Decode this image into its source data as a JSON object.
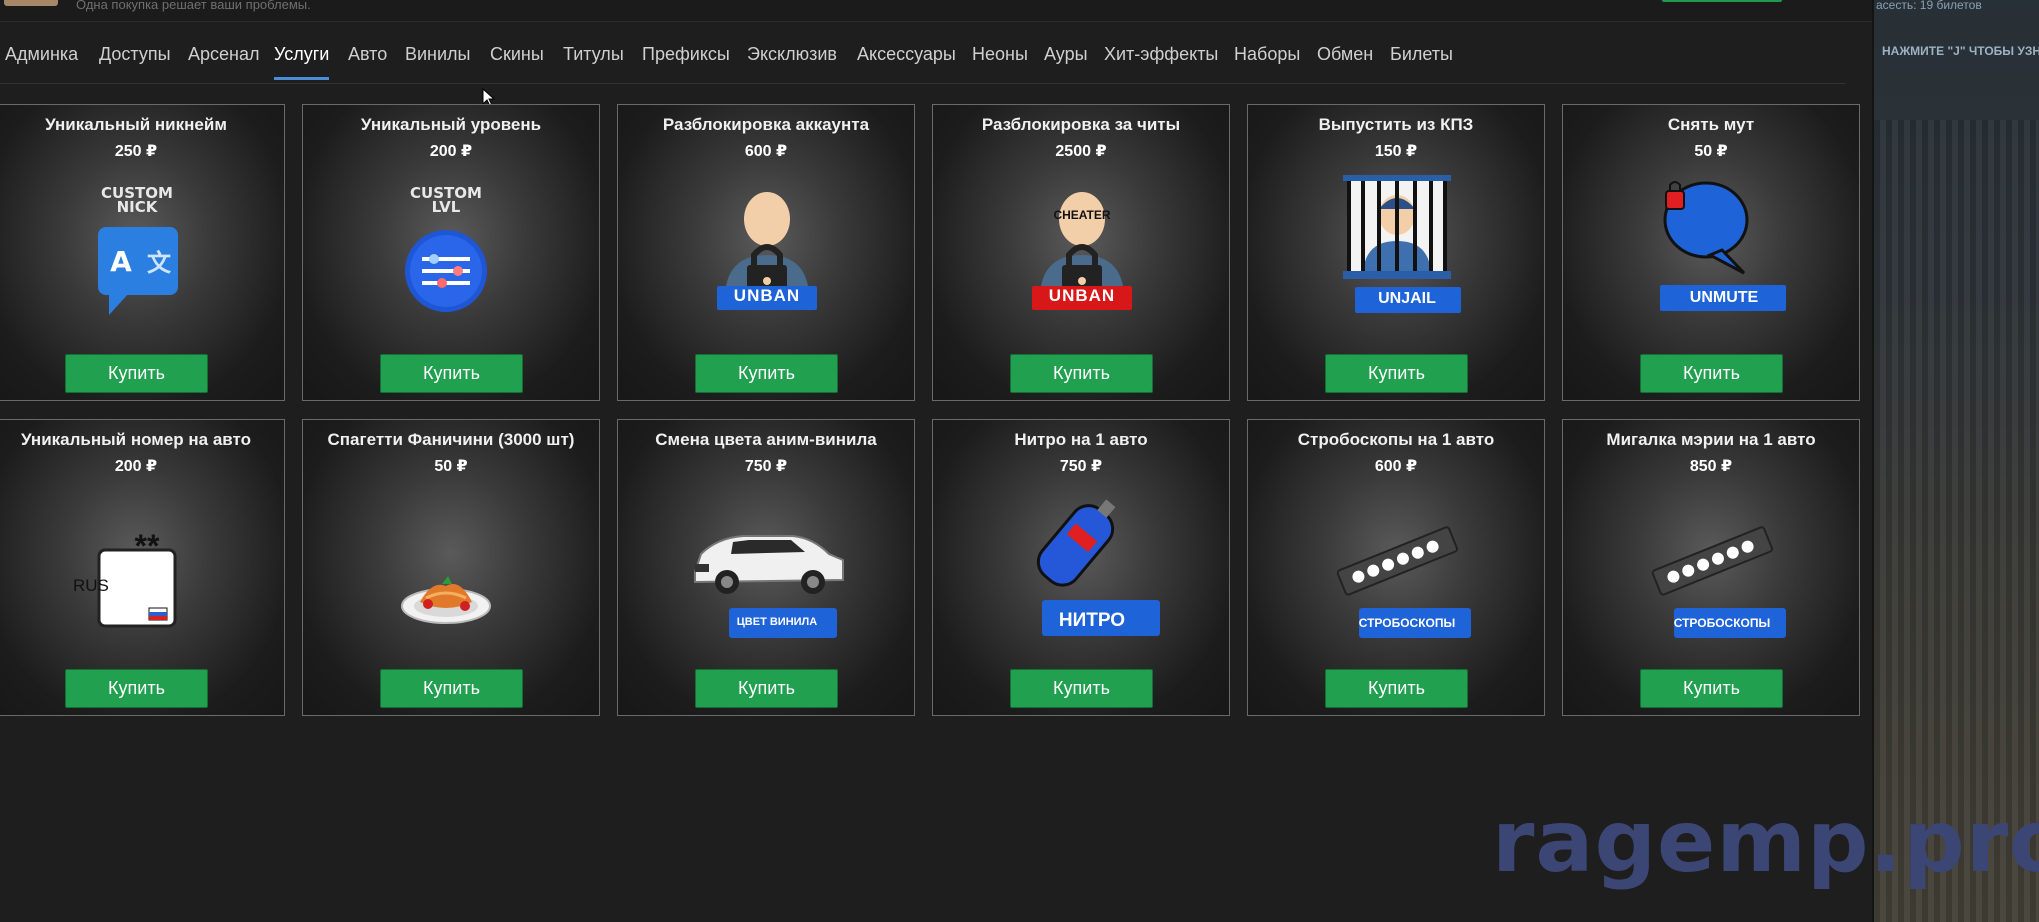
{
  "header": {
    "subtitle": "Одна покупка решает ваши проблемы."
  },
  "side": {
    "tickets": "асесть: 19 билетов",
    "hint": "НАЖМИТЕ \"J\" ЧТОБЫ УЗН"
  },
  "nav": {
    "tabs": [
      {
        "label": "Админка",
        "active": false
      },
      {
        "label": "Доступы",
        "active": false
      },
      {
        "label": "Арсенал",
        "active": false
      },
      {
        "label": "Услуги",
        "active": true
      },
      {
        "label": "Авто",
        "active": false
      },
      {
        "label": "Винилы",
        "active": false
      },
      {
        "label": "Скины",
        "active": false
      },
      {
        "label": "Титулы",
        "active": false
      },
      {
        "label": "Префиксы",
        "active": false
      },
      {
        "label": "Эксклюзив",
        "active": false
      },
      {
        "label": "Аксессуары",
        "active": false
      },
      {
        "label": "Неоны",
        "active": false
      },
      {
        "label": "Ауры",
        "active": false
      },
      {
        "label": "Хит-эффекты",
        "active": false
      },
      {
        "label": "Наборы",
        "active": false
      },
      {
        "label": "Обмен",
        "active": false
      },
      {
        "label": "Билеты",
        "active": false
      }
    ]
  },
  "buy_label": "Купить",
  "cards": [
    {
      "title": "Уникальный никнейм",
      "price": "250 ₽",
      "icon": "custom-nick-icon",
      "badge": "",
      "caption": "CUSTOM NICK"
    },
    {
      "title": "Уникальный уровень",
      "price": "200 ₽",
      "icon": "custom-level-icon",
      "badge": "",
      "caption": "CUSTOM LVL"
    },
    {
      "title": "Разблокировка аккаунта",
      "price": "600 ₽",
      "icon": "unban-icon",
      "badge": "UNBAN",
      "caption": ""
    },
    {
      "title": "Разблокировка за читы",
      "price": "2500 ₽",
      "icon": "cheater-unban-icon",
      "badge": "UNBAN",
      "caption": "CHEATER"
    },
    {
      "title": "Выпустить из КПЗ",
      "price": "150 ₽",
      "icon": "unjail-icon",
      "badge": "UNJAIL",
      "caption": ""
    },
    {
      "title": "Снять мут",
      "price": "50 ₽",
      "icon": "unmute-icon",
      "badge": "UNMUTE",
      "caption": ""
    },
    {
      "title": "Уникальный номер на авто",
      "price": "200 ₽",
      "icon": "license-plate-icon",
      "badge": "RUS",
      "caption": "**"
    },
    {
      "title": "Спагетти Фаничини (3000 шт)",
      "price": "50 ₽",
      "icon": "spaghetti-icon",
      "badge": "",
      "caption": ""
    },
    {
      "title": "Смена цвета аним-винила",
      "price": "750 ₽",
      "icon": "car-icon",
      "badge": "ЦВЕТ ВИНИЛА",
      "caption": ""
    },
    {
      "title": "Нитро на 1 авто",
      "price": "750 ₽",
      "icon": "nitro-icon",
      "badge": "НИТРО",
      "caption": ""
    },
    {
      "title": "Стробоскопы на 1 авто",
      "price": "600 ₽",
      "icon": "strobe-icon",
      "badge": "СТРОБОСКОПЫ",
      "caption": ""
    },
    {
      "title": "Мигалка мэрии на 1 авто",
      "price": "850 ₽",
      "icon": "strobe-icon",
      "badge": "СТРОБОСКОПЫ",
      "caption": ""
    }
  ],
  "watermark": "ragemp.pro",
  "colors": {
    "buy": "#21a050",
    "active_tab": "#4a8fd6",
    "badge_blue": "#1e63d8",
    "badge_red": "#d81818"
  }
}
